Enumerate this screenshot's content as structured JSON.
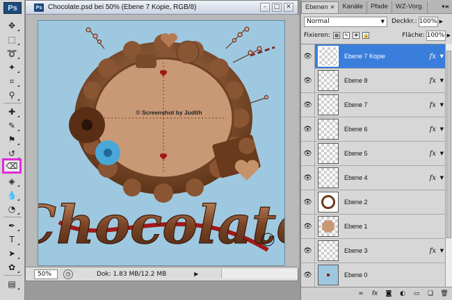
{
  "document": {
    "title": "Chocolate.psd bei 50% (Ebene 7 Kopie, RGB/8)",
    "zoom": "50%",
    "doc_info": "Dok: 1.83 MB/12.2 MB",
    "canvas_watermark": "© Screenshot by Judith",
    "canvas_word": "Chocolate"
  },
  "toolbox": {
    "logo": "Ps"
  },
  "layers_panel": {
    "tabs": [
      "Ebenen",
      "Kanäle",
      "Pfade",
      "WZ-Vorg."
    ],
    "blend_mode": "Normal",
    "opacity_label": "Deckkr.:",
    "opacity_value": "100%",
    "lock_label": "Fixieren:",
    "fill_label": "Fläche:",
    "fill_value": "100%",
    "layers": [
      {
        "name": "Ebene 7 Kopie",
        "fx": true,
        "selected": true
      },
      {
        "name": "Ebene 8",
        "fx": true,
        "selected": false
      },
      {
        "name": "Ebene 7",
        "fx": true,
        "selected": false
      },
      {
        "name": "Ebene 6",
        "fx": true,
        "selected": false
      },
      {
        "name": "Ebene 5",
        "fx": true,
        "selected": false
      },
      {
        "name": "Ebene 4",
        "fx": true,
        "selected": false
      },
      {
        "name": "Ebene 2",
        "fx": false,
        "selected": false
      },
      {
        "name": "Ebene 1",
        "fx": false,
        "selected": false
      },
      {
        "name": "Ebene 3",
        "fx": true,
        "selected": false
      },
      {
        "name": "Ebene 0",
        "fx": false,
        "selected": false
      }
    ],
    "fx_label": "fx"
  },
  "colors": {
    "selection": "#3a7edb",
    "canvas_bg": "#9ec8e0",
    "chocolate": "#7a4a2a",
    "highlight_box": "#e02ad8"
  }
}
